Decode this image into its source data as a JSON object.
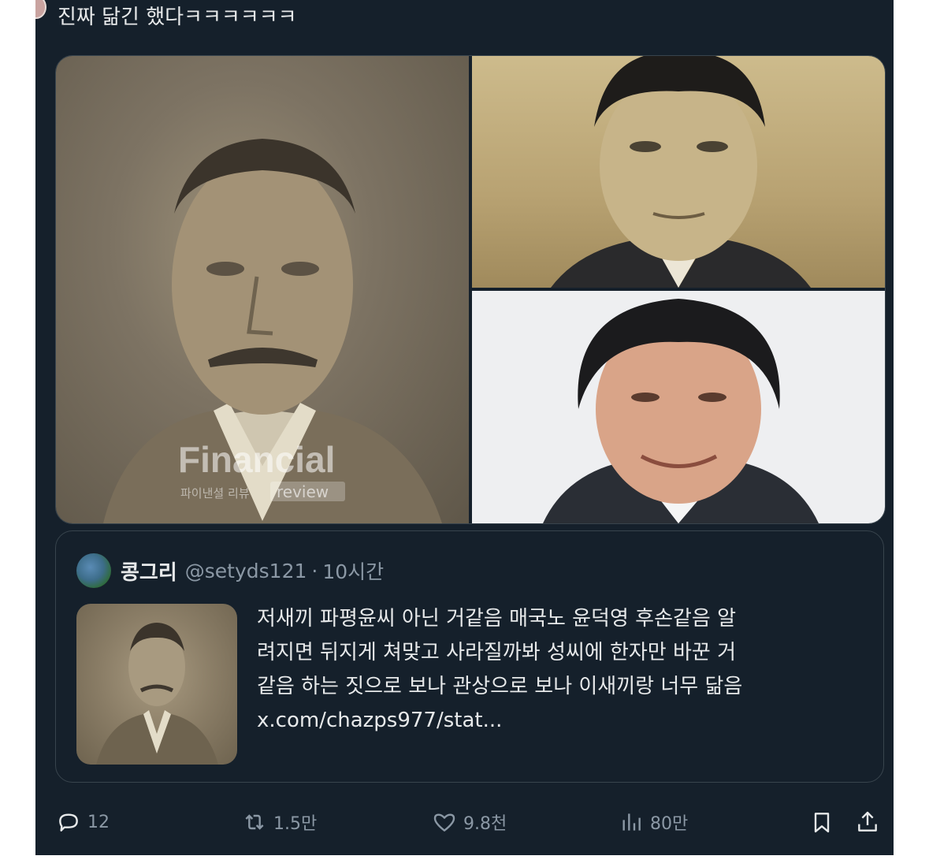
{
  "tweet": {
    "text": "진짜 닮긴 했다ㅋㅋㅋㅋㅋㅋ"
  },
  "media": {
    "watermark_main": "Financial",
    "watermark_sub": "파이낸셜 리뷰",
    "watermark_tag": "review"
  },
  "quote": {
    "name": "콩그리",
    "handle": "@setyds121",
    "separator": "·",
    "time": "10시간",
    "lines": [
      "저새끼 파평윤씨 아닌 거같음 매국노 윤덕영 후손같음 알",
      "려지면 뒤지게 쳐맞고 사라질까봐 성씨에 한자만 바꾼 거",
      "같음 하는 짓으로 보나 관상으로 보나 이새끼랑 너무 닮음",
      "x.com/chazps977/stat..."
    ]
  },
  "actions": {
    "replies": "12",
    "retweets": "1.5만",
    "likes": "9.8천",
    "views": "80만"
  },
  "colors": {
    "background": "#15202b",
    "text": "#e7e9ea",
    "secondary": "#8b98a5",
    "border": "#38444d"
  }
}
